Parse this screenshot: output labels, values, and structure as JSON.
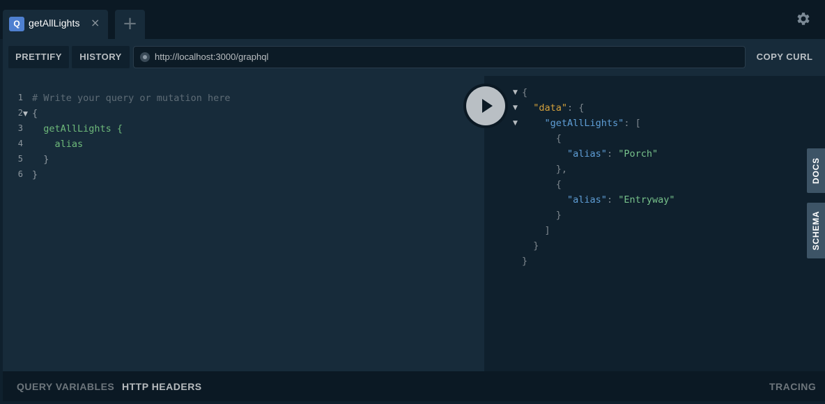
{
  "tabs": [
    {
      "badge": "Q",
      "title": "getAllLights",
      "close": "×"
    }
  ],
  "add_tab_label": "+",
  "toolbar": {
    "prettify": "PRETTIFY",
    "history": "HISTORY",
    "url": "http://localhost:3000/graphql",
    "copy_curl": "COPY CURL"
  },
  "editor": {
    "line_numbers": [
      "1",
      "2",
      "3",
      "4",
      "5",
      "6"
    ],
    "lines": [
      "# Write your query or mutation here",
      "{",
      "  getAllLights {",
      "    alias",
      "  }",
      "}"
    ]
  },
  "result": {
    "lines": [
      "{",
      "  \"data\": {",
      "    \"getAllLights\": [",
      "      {",
      "        \"alias\": \"Porch\"",
      "      },",
      "      {",
      "        \"alias\": \"Entryway\"",
      "      }",
      "    ]",
      "  }",
      "}"
    ],
    "tokens": {
      "data_key": "\"data\"",
      "query_key": "\"getAllLights\"",
      "alias_key": "\"alias\"",
      "alias_1": "\"Porch\"",
      "alias_2": "\"Entryway\""
    }
  },
  "side_tabs": {
    "docs": "DOCS",
    "schema": "SCHEMA"
  },
  "bottom": {
    "query_variables": "QUERY VARIABLES",
    "http_headers": "HTTP HEADERS",
    "tracing": "TRACING"
  },
  "colors": {
    "background": "#0f202d",
    "panel": "#172b3a",
    "accent_badge": "#4f80d0",
    "field_green": "#6eb97a",
    "key_blue": "#5f9ed6",
    "data_orange": "#d4a13c"
  }
}
